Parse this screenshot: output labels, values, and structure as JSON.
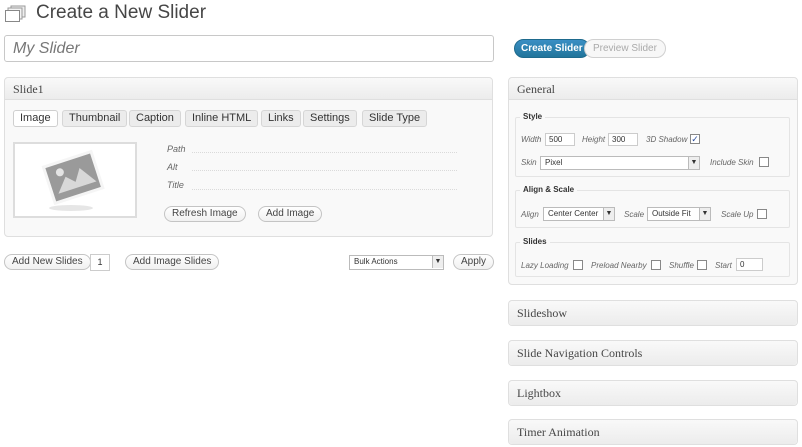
{
  "header": {
    "title": "Create a New Slider"
  },
  "slider_name": {
    "value": "My Slider"
  },
  "actions": {
    "create": "Create Slider",
    "preview": "Preview Slider"
  },
  "slide_panel": {
    "title": "Slide1",
    "tabs": [
      "Image",
      "Thumbnail",
      "Caption",
      "Inline HTML",
      "Links",
      "Settings",
      "Slide Type"
    ],
    "fields": [
      "Path",
      "Alt",
      "Title"
    ],
    "refresh_image": "Refresh Image",
    "add_image": "Add Image"
  },
  "bottom_bar": {
    "add_new_slides": "Add New Slides",
    "count": "1",
    "add_image_slides": "Add Image Slides",
    "bulk_actions": "Bulk Actions",
    "apply": "Apply"
  },
  "general": {
    "title": "General",
    "style": {
      "legend": "Style",
      "width_label": "Width",
      "width_value": "500",
      "height_label": "Height",
      "height_value": "300",
      "shadow_label": "3D Shadow",
      "shadow_checked": true,
      "skin_label": "Skin",
      "skin_value": "Pixel",
      "include_skin_label": "Include Skin"
    },
    "align": {
      "legend": "Align & Scale",
      "align_label": "Align",
      "align_value": "Center Center",
      "scale_label": "Scale",
      "scale_value": "Outside Fit",
      "scaleup_label": "Scale Up"
    },
    "slides": {
      "legend": "Slides",
      "lazy_label": "Lazy Loading",
      "preload_label": "Preload Nearby",
      "shuffle_label": "Shuffle",
      "start_label": "Start",
      "start_value": "0"
    }
  },
  "collapsed_panels": [
    "Slideshow",
    "Slide Navigation Controls",
    "Lightbox",
    "Timer Animation"
  ],
  "icons": {
    "page": "stacked-pages-icon",
    "thumbnail": "image-placeholder-icon",
    "dropdown": "chevron-down-icon",
    "check": "checkmark-icon"
  },
  "colors": {
    "primary": "#21759b",
    "panel_bg": "#f9f9f9",
    "border": "#dfdfdf"
  }
}
